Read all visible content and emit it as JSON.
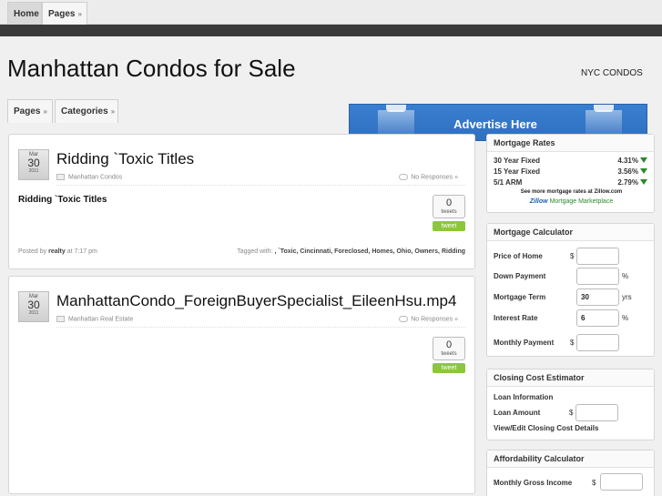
{
  "topnav": {
    "home": "Home",
    "pages": "Pages"
  },
  "header": {
    "title": "Manhattan Condos for Sale",
    "tagline": "NYC CONDOS"
  },
  "secnav": {
    "pages": "Pages",
    "categories": "Categories"
  },
  "advert": {
    "text": "Advertise Here"
  },
  "posts": [
    {
      "month": "Mar",
      "day": "30",
      "year": "2011",
      "title": "Ridding `Toxic Titles",
      "category": "Manhattan Condos",
      "responses": "No Responses »",
      "body": "Ridding `Toxic Titles",
      "tweet_count": "0",
      "tweet_label": "tweets",
      "tweet_button": "tweet",
      "posted_by_prefix": "Posted by",
      "author": "realty",
      "time": "at 7:17 pm",
      "tagged_prefix": "Tagged with:",
      "tags": ", `Toxic, Cincinnati, Foreclosed, Homes, Ohio, Owners, Ridding"
    },
    {
      "month": "Mar",
      "day": "30",
      "year": "2011",
      "title": "ManhattanCondo_ForeignBuyerSpecialist_EileenHsu.mp4",
      "category": "Manhattan Real Estate",
      "responses": "No Responses »",
      "tweet_count": "0",
      "tweet_label": "tweets",
      "tweet_button": "tweet"
    }
  ],
  "rates": {
    "title": "Mortgage Rates",
    "rows": [
      {
        "label": "30 Year Fixed",
        "value": "4.31%"
      },
      {
        "label": "15 Year Fixed",
        "value": "3.56%"
      },
      {
        "label": "5/1 ARM",
        "value": "2.79%"
      }
    ],
    "more": "See more mortgage rates at Zillow.com",
    "zillow_brand": "Zillow",
    "zillow_text": "Mortgage Marketplace",
    "arrow_color": "#2a8a2a"
  },
  "calculator": {
    "title": "Mortgage Calculator",
    "price_label": "Price of Home",
    "price_sym": "$",
    "price_value": "",
    "down_label": "Down Payment",
    "down_sym": "%",
    "down_value": "",
    "term_label": "Mortgage Term",
    "term_value": "30",
    "term_unit": "yrs",
    "rate_label": "Interest Rate",
    "rate_value": "6",
    "rate_sym": "%",
    "monthly_label": "Monthly Payment",
    "monthly_sym": "$",
    "monthly_value": ""
  },
  "closing": {
    "title": "Closing Cost Estimator",
    "loan_info": "Loan Information",
    "loan_amount_label": "Loan Amount",
    "loan_sym": "$",
    "loan_value": "",
    "details_link": "View/Edit Closing Cost Details"
  },
  "afford": {
    "title": "Affordability Calculator",
    "income_label": "Monthly Gross Income",
    "income_sym": "$",
    "income_value": ""
  },
  "colors": {
    "tweet_button": "#8cc63e",
    "advert": "#3a7fd0",
    "dark_bar": "#3a3a3a"
  }
}
